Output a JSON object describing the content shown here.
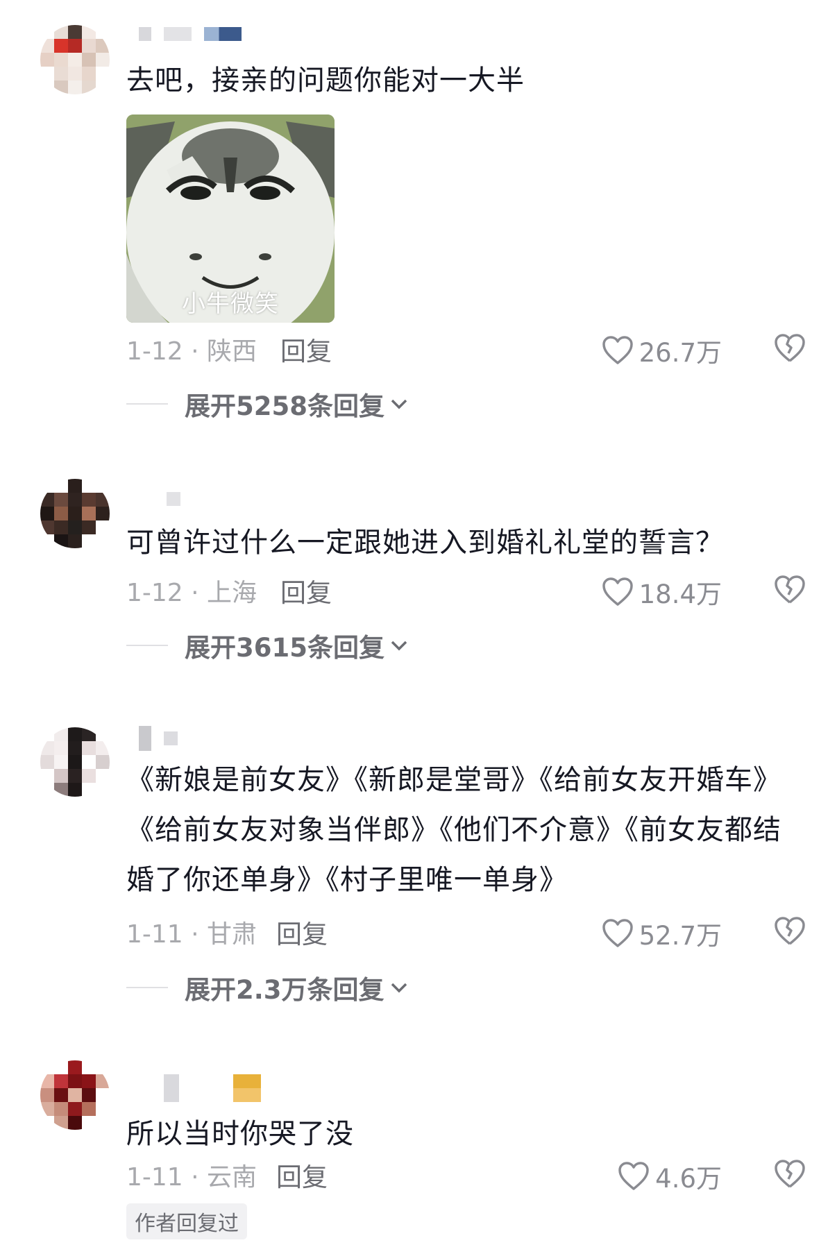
{
  "comments": [
    {
      "text": "去吧，接亲的问题你能对一大半",
      "sticker_caption": "小牛微笑",
      "date_location": "1-12 · 陕西",
      "reply_label": "回复",
      "likes": "26.7万",
      "expand_label": "展开5258条回复"
    },
    {
      "text": "可曾许过什么一定跟她进入到婚礼礼堂的誓言？",
      "date_location": "1-12 · 上海",
      "reply_label": "回复",
      "likes": "18.4万",
      "expand_label": "展开3615条回复"
    },
    {
      "text": "《新娘是前女友》《新郎是堂哥》《给前女友开婚车》《给前女友对象当伴郎》《他们不介意》《前女友都结婚了你还单身》《村子里唯一单身》",
      "date_location": "1-11 · 甘肃",
      "reply_label": "回复",
      "likes": "52.7万",
      "expand_label": "展开2.3万条回复"
    },
    {
      "text": "所以当时你哭了没",
      "date_location": "1-11 · 云南",
      "reply_label": "回复",
      "likes": "4.6万",
      "badge": "作者回复过"
    }
  ],
  "icons": {
    "like": "heart-outline-icon",
    "dislike": "broken-heart-icon",
    "expand": "chevron-down-icon"
  }
}
